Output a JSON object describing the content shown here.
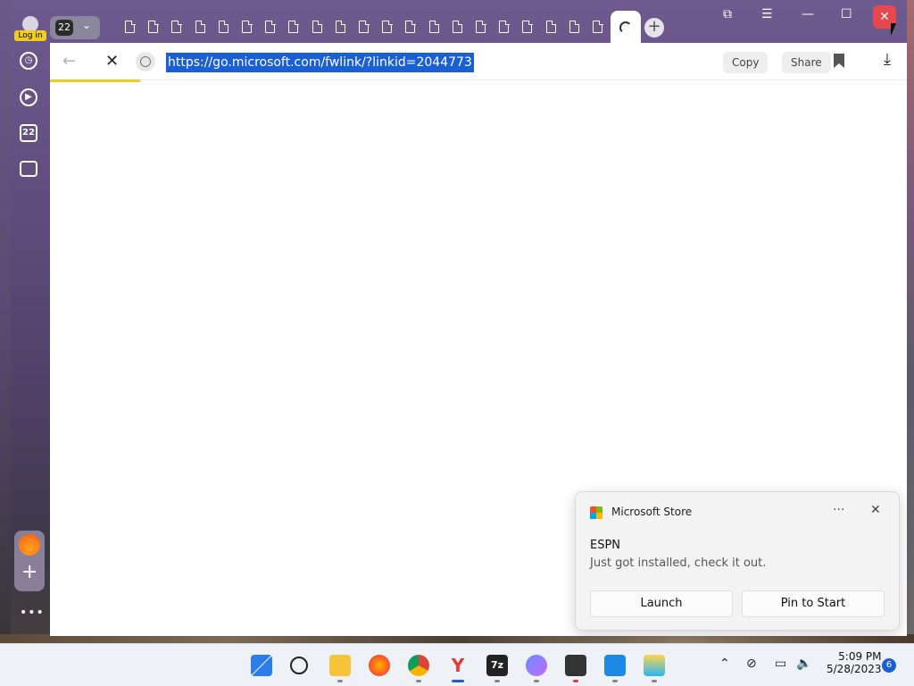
{
  "profile": {
    "login_label": "Log in"
  },
  "tabs": {
    "count": "22",
    "tab_icon_count": 21
  },
  "window": {
    "close_glyph": "✕",
    "minimize_glyph": "—",
    "maximize_glyph": "☐",
    "menu_glyph": "☰"
  },
  "sidebar": {
    "counter": "22",
    "more_glyph": "•••"
  },
  "address": {
    "url": "https://go.microsoft.com/fwlink/?linkid=2044773",
    "copy_label": "Copy",
    "share_label": "Share",
    "load_progress": 0.105
  },
  "toast": {
    "app_name": "Microsoft Store",
    "title": "ESPN",
    "message": "Just got installed, check it out.",
    "launch_label": "Launch",
    "pin_label": "Pin to Start"
  },
  "taskbar": {
    "time": "5:09 PM",
    "date": "5/28/2023",
    "notification_count": "6"
  },
  "colors": {
    "accent": "#1a5fd4",
    "brand_yellow": "#f2cd1d",
    "close_red": "#e5484d"
  }
}
